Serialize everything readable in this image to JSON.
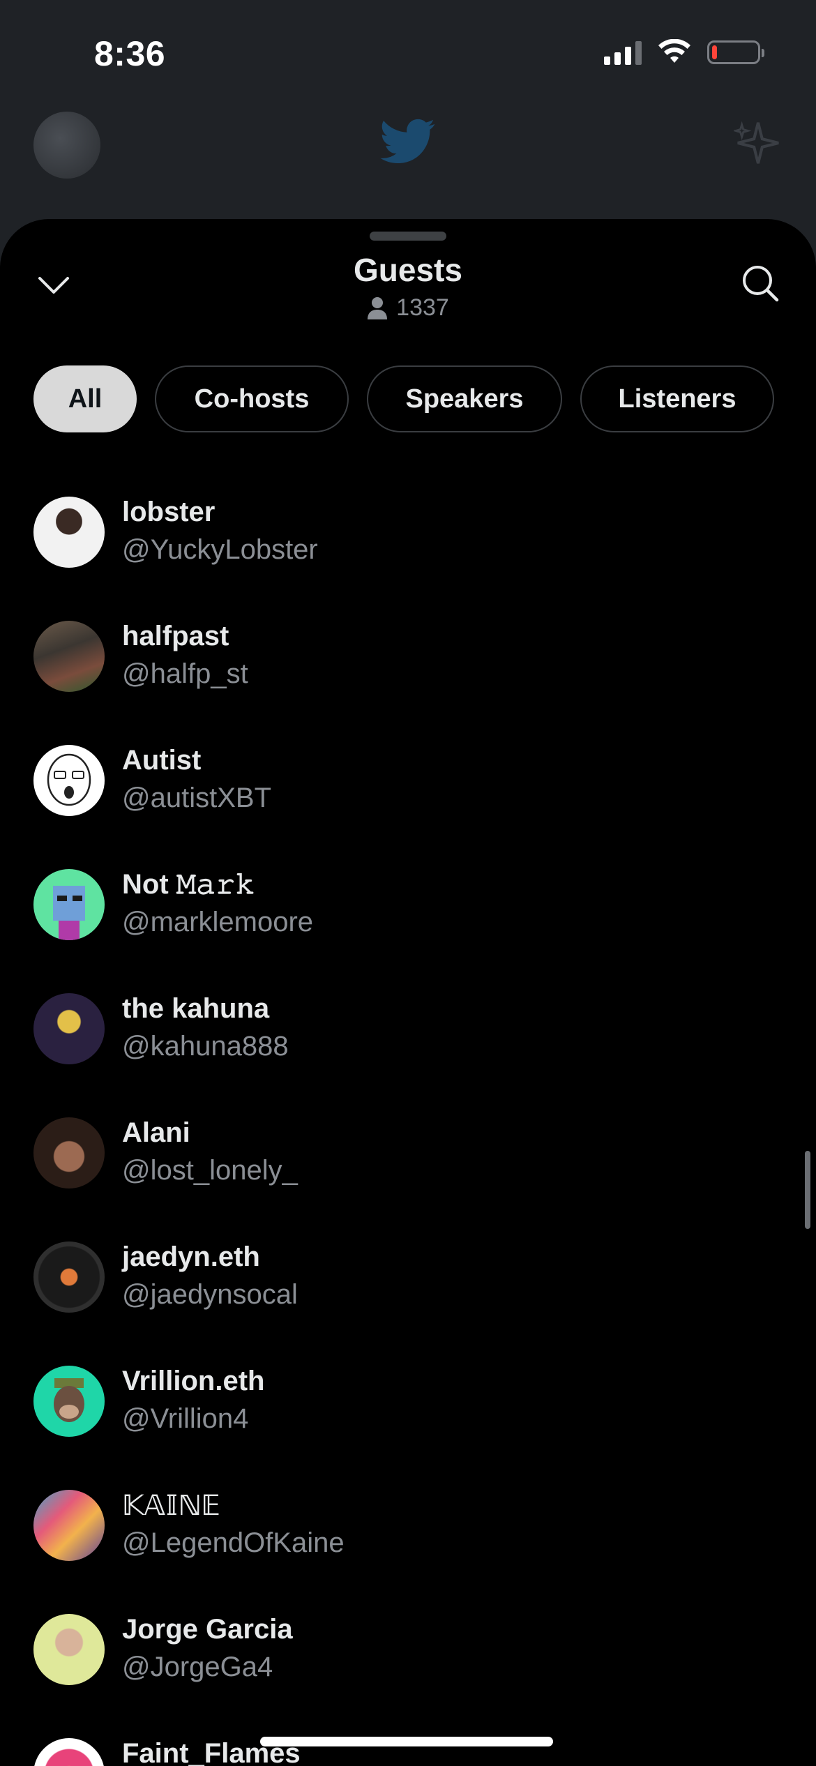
{
  "status_bar": {
    "time": "8:36",
    "battery_level": 0.12,
    "battery_color": "#ff453a"
  },
  "sheet": {
    "title": "Guests",
    "count": "1337",
    "tabs": [
      {
        "label": "All",
        "active": true
      },
      {
        "label": "Co-hosts",
        "active": false
      },
      {
        "label": "Speakers",
        "active": false
      },
      {
        "label": "Listeners",
        "active": false
      }
    ],
    "guests": [
      {
        "name": "lobster",
        "handle": "@YuckyLobster",
        "avatar": "white-portrait"
      },
      {
        "name": "halfpast",
        "handle": "@halfp_st",
        "avatar": "photo-outdoor"
      },
      {
        "name": "Autist",
        "handle": "@autistXBT",
        "avatar": "cartoon-face"
      },
      {
        "name": "Not 𝙼𝚊𝚛𝚔",
        "handle": "@marklemoore",
        "avatar": "pixel-punk"
      },
      {
        "name": "the kahuna",
        "handle": "@kahuna888",
        "avatar": "gold-figure"
      },
      {
        "name": "Alani",
        "handle": "@lost_lonely_",
        "avatar": "portrait"
      },
      {
        "name": "jaedyn.eth",
        "handle": "@jaedynsocal",
        "avatar": "vinyl-record"
      },
      {
        "name": "Vrillion.eth",
        "handle": "@Vrillion4",
        "avatar": "ape-nft"
      },
      {
        "name": "𝕂𝔸𝕀ℕ𝔼",
        "handle": "@LegendOfKaine",
        "avatar": "colorful-art"
      },
      {
        "name": "Jorge Garcia",
        "handle": "@JorgeGa4",
        "avatar": "portrait-guitar"
      },
      {
        "name": "Faint_Flames",
        "handle": "",
        "avatar": "flower"
      }
    ]
  },
  "colors": {
    "accent_twitter": "#1d9bf0",
    "sheet_bg": "#000000",
    "muted_text": "#8b8f95"
  }
}
